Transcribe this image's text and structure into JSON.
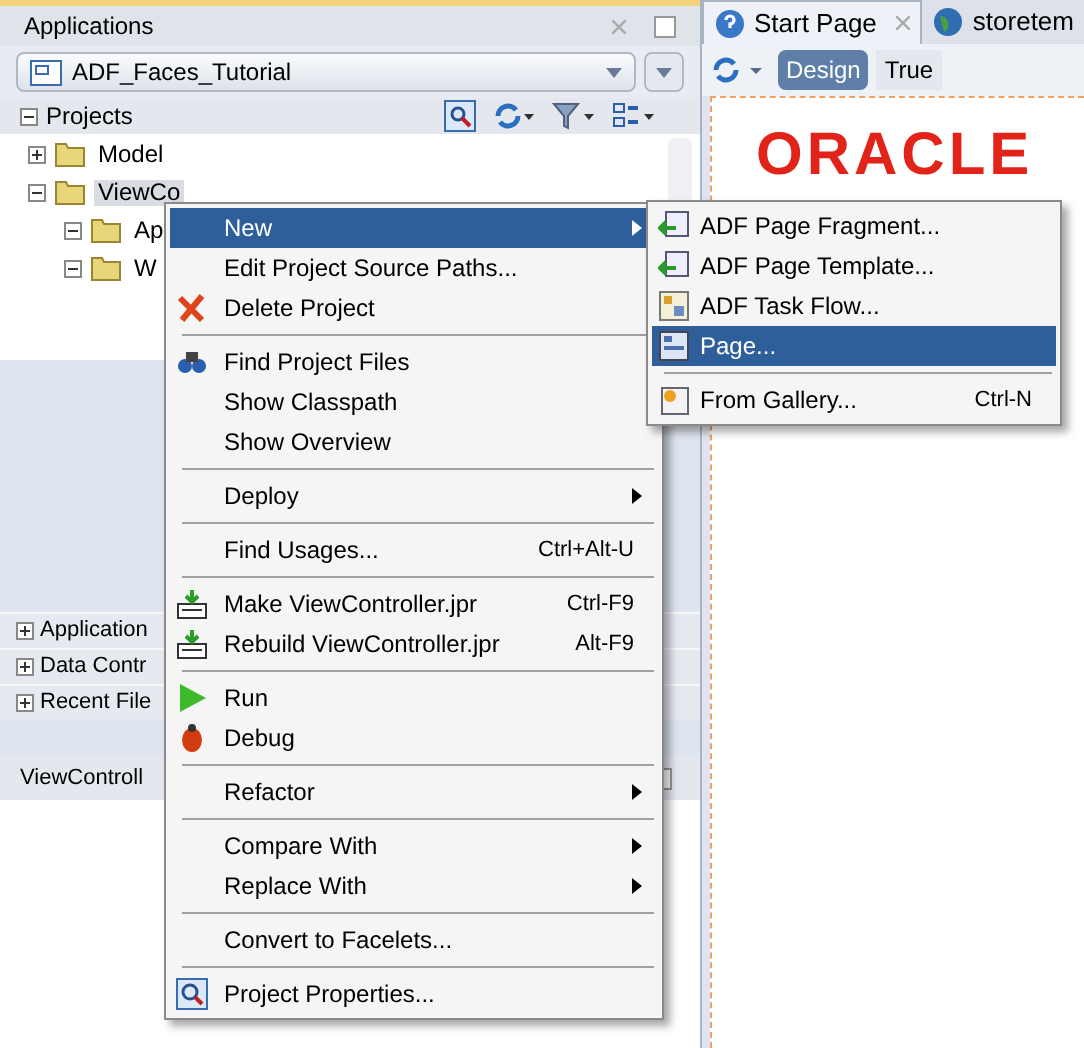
{
  "applications_panel": {
    "title": "Applications",
    "application": "ADF_Faces_Tutorial"
  },
  "projects": {
    "title": "Projects",
    "tree": [
      {
        "label": "Model",
        "expanded": false,
        "selected": false
      },
      {
        "label": "ViewCo",
        "expanded": true,
        "selected": true,
        "children": [
          {
            "label": "Ap",
            "expanded": true,
            "selected": false
          },
          {
            "label": "W",
            "expanded": true,
            "selected": false
          }
        ]
      }
    ]
  },
  "accordion": [
    {
      "label": "Application"
    },
    {
      "label": "Data Contr"
    },
    {
      "label": "Recent File"
    }
  ],
  "structure_panel": {
    "title": "ViewControll"
  },
  "editor_tabs": [
    {
      "label": "Start Page",
      "selected": true
    },
    {
      "label": "storetem",
      "selected": false
    }
  ],
  "editor_toolbar": [
    {
      "label": "Design",
      "selected": true
    },
    {
      "label": "True",
      "selected": false
    }
  ],
  "logo": "ORACLE",
  "context_menu": [
    {
      "kind": "item",
      "label": "New",
      "submenu": true,
      "selected": true
    },
    {
      "kind": "item",
      "label": "Edit Project Source Paths...",
      "selected": false
    },
    {
      "kind": "item",
      "label": "Delete Project",
      "selected": false
    },
    {
      "kind": "separator"
    },
    {
      "kind": "item",
      "label": "Find Project Files",
      "selected": false
    },
    {
      "kind": "item",
      "label": "Show Classpath",
      "selected": false
    },
    {
      "kind": "item",
      "label": "Show Overview",
      "selected": false
    },
    {
      "kind": "separator"
    },
    {
      "kind": "item",
      "label": "Deploy",
      "submenu": true,
      "selected": false
    },
    {
      "kind": "separator"
    },
    {
      "kind": "item",
      "label": "Find Usages...",
      "shortcut": "Ctrl+Alt-U",
      "selected": false
    },
    {
      "kind": "separator"
    },
    {
      "kind": "item",
      "label": "Make ViewController.jpr",
      "shortcut": "Ctrl-F9",
      "selected": false
    },
    {
      "kind": "item",
      "label": "Rebuild ViewController.jpr",
      "shortcut": "Alt-F9",
      "selected": false
    },
    {
      "kind": "separator"
    },
    {
      "kind": "item",
      "label": "Run",
      "selected": false
    },
    {
      "kind": "item",
      "label": "Debug",
      "selected": false
    },
    {
      "kind": "separator"
    },
    {
      "kind": "item",
      "label": "Refactor",
      "submenu": true,
      "selected": false
    },
    {
      "kind": "separator"
    },
    {
      "kind": "item",
      "label": "Compare With",
      "submenu": true,
      "selected": false
    },
    {
      "kind": "item",
      "label": "Replace With",
      "submenu": true,
      "selected": false
    },
    {
      "kind": "separator"
    },
    {
      "kind": "item",
      "label": "Convert to Facelets...",
      "selected": false
    },
    {
      "kind": "separator"
    },
    {
      "kind": "item",
      "label": "Project Properties...",
      "selected": false
    }
  ],
  "submenu": [
    {
      "kind": "item",
      "label": "ADF Page Fragment...",
      "selected": false
    },
    {
      "kind": "item",
      "label": "ADF Page Template...",
      "selected": false
    },
    {
      "kind": "item",
      "label": "ADF Task Flow...",
      "selected": false
    },
    {
      "kind": "item",
      "label": "Page...",
      "selected": true
    },
    {
      "kind": "separator"
    },
    {
      "kind": "item",
      "label": "From Gallery...",
      "shortcut": "Ctrl-N",
      "selected": false
    }
  ]
}
